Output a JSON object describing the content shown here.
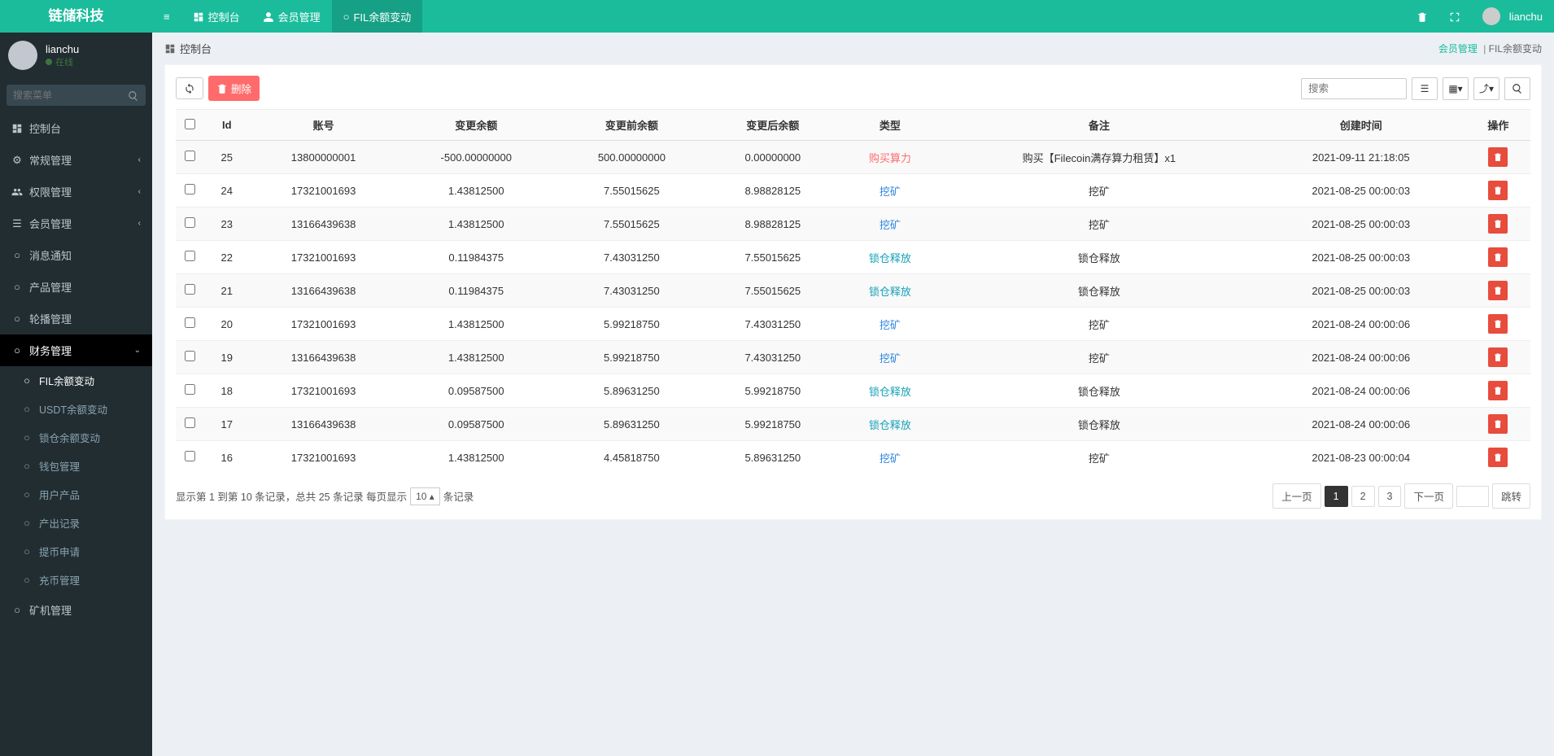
{
  "brand": "链储科技",
  "header": {
    "console": "控制台",
    "member": "会员管理",
    "fil": "FIL余额变动",
    "username": "lianchu"
  },
  "user": {
    "name": "lianchu",
    "status": "在线"
  },
  "search_placeholder": "搜索菜单",
  "menu": {
    "console": "控制台",
    "general": "常规管理",
    "perm": "权限管理",
    "member": "会员管理",
    "notice": "消息通知",
    "product": "产品管理",
    "carousel": "轮播管理",
    "finance": "财务管理",
    "sub_fil": "FIL余额变动",
    "sub_usdt": "USDT余额变动",
    "sub_lock": "锁仓余额变动",
    "sub_wallet": "钱包管理",
    "sub_userprod": "用户产品",
    "sub_output": "产出记录",
    "sub_withdraw": "提币申请",
    "sub_deposit": "充币管理",
    "miner": "矿机管理"
  },
  "crumb": {
    "dash": "控制台",
    "member": "会员管理",
    "fil": "FIL余额变动"
  },
  "toolbar": {
    "delete": "删除",
    "search_ph": "搜索"
  },
  "columns": {
    "id": "Id",
    "account": "账号",
    "amount": "变更余额",
    "before": "变更前余额",
    "after": "变更后余额",
    "type": "类型",
    "remark": "备注",
    "created": "创建时间",
    "op": "操作"
  },
  "types": {
    "buy": "购买算力",
    "mine": "挖矿",
    "lock": "锁仓释放"
  },
  "rows": [
    {
      "id": "25",
      "account": "13800000001",
      "amount": "-500.00000000",
      "before": "500.00000000",
      "after": "0.00000000",
      "type": "buy",
      "remark": "购买【Filecoin满存算力租赁】x1",
      "created": "2021-09-11 21:18:05"
    },
    {
      "id": "24",
      "account": "17321001693",
      "amount": "1.43812500",
      "before": "7.55015625",
      "after": "8.98828125",
      "type": "mine",
      "remark": "挖矿",
      "created": "2021-08-25 00:00:03"
    },
    {
      "id": "23",
      "account": "13166439638",
      "amount": "1.43812500",
      "before": "7.55015625",
      "after": "8.98828125",
      "type": "mine",
      "remark": "挖矿",
      "created": "2021-08-25 00:00:03"
    },
    {
      "id": "22",
      "account": "17321001693",
      "amount": "0.11984375",
      "before": "7.43031250",
      "after": "7.55015625",
      "type": "lock",
      "remark": "锁仓释放",
      "created": "2021-08-25 00:00:03"
    },
    {
      "id": "21",
      "account": "13166439638",
      "amount": "0.11984375",
      "before": "7.43031250",
      "after": "7.55015625",
      "type": "lock",
      "remark": "锁仓释放",
      "created": "2021-08-25 00:00:03"
    },
    {
      "id": "20",
      "account": "17321001693",
      "amount": "1.43812500",
      "before": "5.99218750",
      "after": "7.43031250",
      "type": "mine",
      "remark": "挖矿",
      "created": "2021-08-24 00:00:06"
    },
    {
      "id": "19",
      "account": "13166439638",
      "amount": "1.43812500",
      "before": "5.99218750",
      "after": "7.43031250",
      "type": "mine",
      "remark": "挖矿",
      "created": "2021-08-24 00:00:06"
    },
    {
      "id": "18",
      "account": "17321001693",
      "amount": "0.09587500",
      "before": "5.89631250",
      "after": "5.99218750",
      "type": "lock",
      "remark": "锁仓释放",
      "created": "2021-08-24 00:00:06"
    },
    {
      "id": "17",
      "account": "13166439638",
      "amount": "0.09587500",
      "before": "5.89631250",
      "after": "5.99218750",
      "type": "lock",
      "remark": "锁仓释放",
      "created": "2021-08-24 00:00:06"
    },
    {
      "id": "16",
      "account": "17321001693",
      "amount": "1.43812500",
      "before": "4.45818750",
      "after": "5.89631250",
      "type": "mine",
      "remark": "挖矿",
      "created": "2021-08-23 00:00:04"
    }
  ],
  "footer": {
    "info_pre": "显示第 1 到第 10 条记录，总共 25 条记录 每页显示",
    "info_post": "条记录",
    "per_page": "10 ▴",
    "prev": "上一页",
    "next": "下一页",
    "jump": "跳转",
    "pages": [
      "1",
      "2",
      "3"
    ]
  }
}
